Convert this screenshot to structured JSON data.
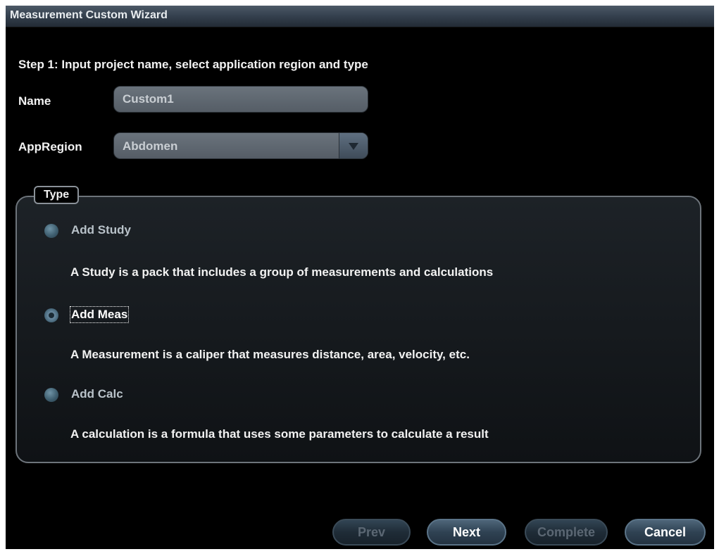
{
  "window": {
    "title": "Measurement Custom Wizard"
  },
  "step": {
    "label": "Step 1: Input project name, select application region and type"
  },
  "name_field": {
    "label": "Name",
    "value": "Custom1"
  },
  "app_region": {
    "label": "AppRegion",
    "selected": "Abdomen",
    "arrow_icon": "triangle-down-icon"
  },
  "type_group": {
    "legend": "Type",
    "selected_index": 1,
    "options": [
      {
        "label": "Add Study",
        "description": "A Study is a pack that includes a group of measurements and calculations",
        "checked": false
      },
      {
        "label": "Add Meas",
        "description": "A Measurement is a caliper that measures distance, area, velocity, etc.",
        "checked": true
      },
      {
        "label": "Add Calc",
        "description": "A calculation is a formula that uses some parameters to calculate a result",
        "checked": false
      }
    ]
  },
  "buttons": {
    "prev": {
      "label": "Prev",
      "enabled": false
    },
    "next": {
      "label": "Next",
      "enabled": true
    },
    "complete": {
      "label": "Complete",
      "enabled": false
    },
    "cancel": {
      "label": "Cancel",
      "enabled": true
    }
  },
  "colors": {
    "background": "#000000",
    "titlebar": "#364250",
    "text": "#f2f2f2",
    "input_bg": "#5f6870",
    "button": "#2f4253",
    "disabled_text": "#5b6773"
  }
}
